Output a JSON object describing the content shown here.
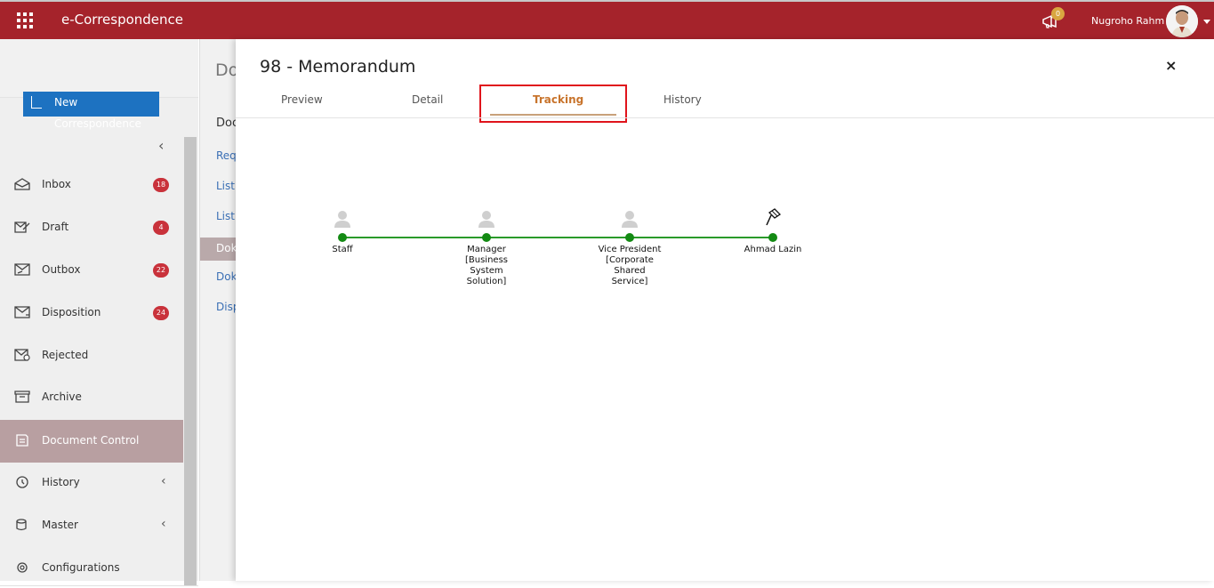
{
  "header": {
    "app_title": "e-Correspondence",
    "notification_count": "0",
    "user_name": "Nugroho Rahm",
    "brand_color": "#a5232b"
  },
  "sidebar": {
    "new_button_label": "New Correspondence",
    "items": [
      {
        "label": "Inbox",
        "badge": "18",
        "icon": "inbox-icon"
      },
      {
        "label": "Draft",
        "badge": "4",
        "icon": "draft-icon"
      },
      {
        "label": "Outbox",
        "badge": "22",
        "icon": "outbox-icon"
      },
      {
        "label": "Disposition",
        "badge": "24",
        "icon": "disposition-icon"
      },
      {
        "label": "Rejected",
        "badge": "",
        "icon": "rejected-icon"
      },
      {
        "label": "Archive",
        "badge": "",
        "icon": "archive-icon"
      },
      {
        "label": "Document Control",
        "badge": "",
        "icon": "document-control-icon"
      },
      {
        "label": "History",
        "badge": "",
        "icon": "history-icon"
      },
      {
        "label": "Master",
        "badge": "",
        "icon": "master-icon"
      },
      {
        "label": "Configurations",
        "badge": "",
        "icon": "gear-icon"
      }
    ]
  },
  "background_page": {
    "title": "Do",
    "subtitle": "Doc",
    "links": [
      "Requ",
      "List",
      "List",
      "Doku",
      "Doku",
      "Disp"
    ]
  },
  "modal": {
    "title": "98 - Memorandum",
    "tabs": [
      "Preview",
      "Detail",
      "Tracking",
      "History"
    ],
    "active_tab": "Tracking",
    "close_label": "×"
  },
  "tracking": {
    "nodes": [
      {
        "label": "Staff",
        "icon": "person-icon"
      },
      {
        "label": "Manager [Business System Solution]",
        "icon": "person-icon"
      },
      {
        "label": "Vice President [Corporate Shared Service]",
        "icon": "person-icon"
      },
      {
        "label": "Ahmad Lazin",
        "icon": "flag-icon"
      }
    ],
    "line_color": "#2a9a2a"
  }
}
